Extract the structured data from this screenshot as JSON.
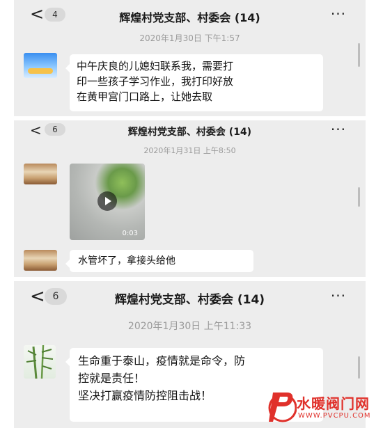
{
  "screens": [
    {
      "header": {
        "back": "<",
        "badge": "4",
        "title": "辉煌村党支部、村委会 (14)",
        "more": "···"
      },
      "timestamp": "2020年1月30日 下午1:57",
      "message": {
        "lines": [
          "中午庆良的儿媳妇联系我，需要打",
          "印一些孩子学习作业，我打印好放",
          "在黄甲宫门口路上，让她去取"
        ]
      }
    },
    {
      "header": {
        "back": "<",
        "badge": "6",
        "title": "辉煌村党支部、村委会 (14)",
        "more": "···"
      },
      "timestamp": "2020年1月31日 上午8:50",
      "video": {
        "duration": "0:03"
      },
      "message": {
        "text": "水管坏了，拿接头给他"
      }
    },
    {
      "header": {
        "back": "<",
        "badge": "6",
        "title": "辉煌村党支部、村委会 (14)",
        "more": "···"
      },
      "timestamp": "2020年1月30日 上午11:33",
      "message": {
        "lines": [
          "生命重于泰山，疫情就是命令，防",
          "控就是责任！",
          "坚决打赢疫情防控阻击战！"
        ]
      }
    }
  ],
  "watermark": {
    "name": "水暖阀门网",
    "url": "WWW.PVCPU.COM"
  },
  "colors": {
    "chat_bg": "#ededed",
    "bubble": "#ffffff",
    "timestamp": "#9a9a9a",
    "watermark": "#e0312b"
  }
}
